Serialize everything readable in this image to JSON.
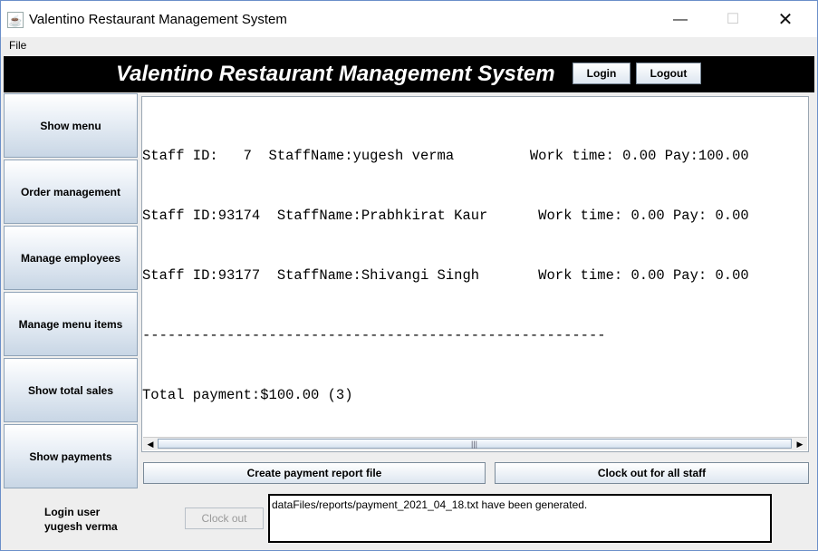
{
  "window": {
    "title": "Valentino Restaurant Management System",
    "controls": {
      "minimize": "—",
      "maximize": "☐",
      "close": "✕"
    }
  },
  "menubar": {
    "file": "File"
  },
  "header": {
    "title": "Valentino Restaurant Management System",
    "login": "Login",
    "logout": "Logout"
  },
  "sidebar": {
    "items": [
      {
        "label": "Show menu"
      },
      {
        "label": "Order management"
      },
      {
        "label": "Manage employees"
      },
      {
        "label": "Manage menu items"
      },
      {
        "label": "Show total sales"
      },
      {
        "label": "Show payments"
      }
    ]
  },
  "report": {
    "lines": [
      "Staff ID:   7  StaffName:yugesh verma         Work time: 0.00 Pay:100.00",
      "Staff ID:93174  StaffName:Prabhkirat Kaur      Work time: 0.00 Pay: 0.00",
      "Staff ID:93177  StaffName:Shivangi Singh       Work time: 0.00 Pay: 0.00",
      "-------------------------------------------------------",
      "Total payment:$100.00 (3)"
    ]
  },
  "actions": {
    "create_report": "Create payment report file",
    "clock_out_all": "Clock out for all staff"
  },
  "footer": {
    "login_user_label": "Login user",
    "login_user_name": "yugesh verma",
    "clock_out": "Clock out",
    "status_message": "dataFiles/reports/payment_2021_04_18.txt have been generated."
  },
  "icons": {
    "app": "java-cup-icon",
    "scroll_left": "arrow-left-icon",
    "scroll_right": "arrow-right-icon"
  }
}
